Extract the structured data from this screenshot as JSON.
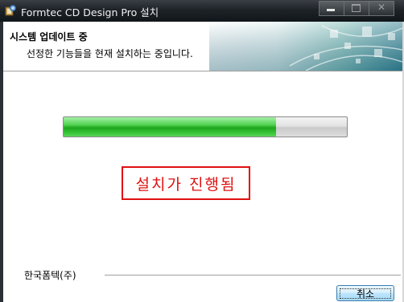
{
  "window": {
    "title": "Formtec CD Design Pro 설치"
  },
  "banner": {
    "heading": "시스템 업데이트 중",
    "subtext": "선정한 기능들을 현재 설치하는 중입니다."
  },
  "progress": {
    "fraction": 0.75
  },
  "status": {
    "label": "설치가 진행됨"
  },
  "footer": {
    "brand": "한국폼텍(주)",
    "cancel_label": "취소"
  },
  "colors": {
    "status_red": "#e01010",
    "progress_green": "#2dbb2d"
  }
}
